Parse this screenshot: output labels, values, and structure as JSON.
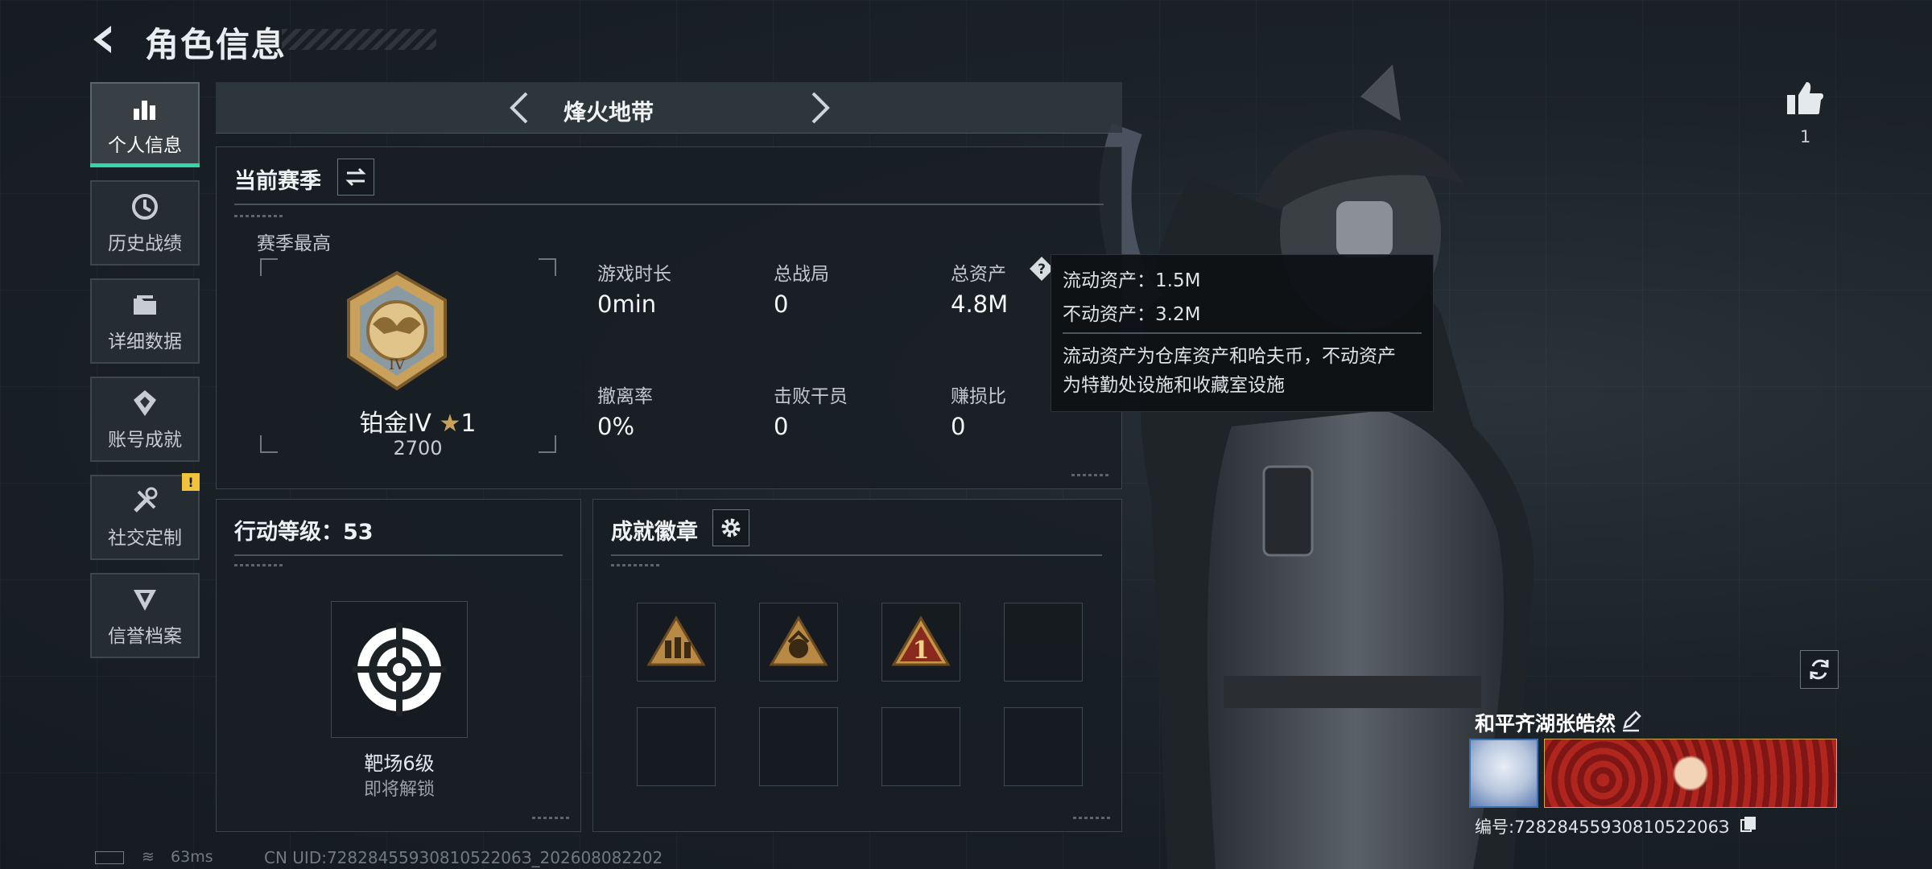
{
  "header": {
    "title": "角色信息"
  },
  "sidebar": {
    "items": [
      {
        "label": "个人信息",
        "icon": "bar-chart-icon",
        "active": true
      },
      {
        "label": "历史战绩",
        "icon": "history-clock-icon"
      },
      {
        "label": "详细数据",
        "icon": "folder-icon"
      },
      {
        "label": "账号成就",
        "icon": "achievement-icon"
      },
      {
        "label": "社交定制",
        "icon": "tools-icon",
        "badge": "!"
      },
      {
        "label": "信誉档案",
        "icon": "credit-emblem-icon"
      }
    ]
  },
  "mode_bar": {
    "title": "烽火地带"
  },
  "season": {
    "title": "当前赛季",
    "best_label": "赛季最高",
    "rank": "铂金IV",
    "stars": "1",
    "score": "2700",
    "stats": [
      {
        "label": "游戏时长",
        "value": "0min"
      },
      {
        "label": "总战局",
        "value": "0"
      },
      {
        "label": "总资产",
        "value": "4.8M"
      },
      {
        "label": "撤离率",
        "value": "0%"
      },
      {
        "label": "击败干员",
        "value": "0"
      },
      {
        "label": "赚损比",
        "value": "0"
      }
    ]
  },
  "tooltip": {
    "liquid": "流动资产：1.5M",
    "fixed": "不动资产：3.2M",
    "desc_line1": "流动资产为仓库资产和哈夫币，不动资产",
    "desc_line2": "为特勤处设施和收藏室设施"
  },
  "level": {
    "title": "行动等级：53",
    "item_name": "靶场6级",
    "item_status": "即将解锁"
  },
  "badges": {
    "title": "成就徽章",
    "slots": [
      {
        "icon": "soldiers-triangle-badge-icon",
        "filled": true
      },
      {
        "icon": "emblem-triangle-badge-icon",
        "filled": true
      },
      {
        "icon": "number-one-triangle-badge-icon",
        "filled": true
      },
      {
        "filled": false
      },
      {
        "filled": false
      },
      {
        "filled": false
      },
      {
        "filled": false
      },
      {
        "filled": false
      }
    ]
  },
  "profile": {
    "likes": "1",
    "player_name": "和平齐湖张皓然",
    "player_id": "编号:7282845593081052206З"
  },
  "footer": {
    "ping": "63ms",
    "uid": "CN UID:7282845593081052206З_202608082202"
  },
  "colors": {
    "accent": "#33d6a6",
    "warning": "#f0c33c",
    "gold": "#c9a15a"
  }
}
